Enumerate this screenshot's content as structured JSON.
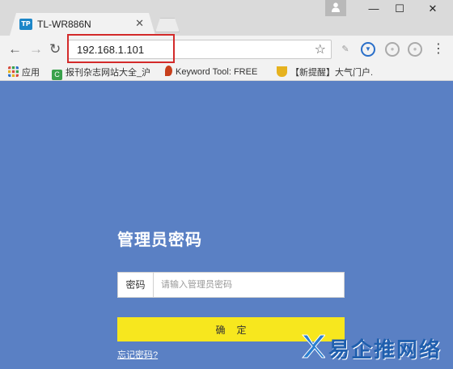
{
  "browser": {
    "tab_title": "TL-WR886N",
    "tab_favicon": "TP",
    "url": "192.168.1.101",
    "window_controls": {
      "minimize": "—",
      "maximize": "☐",
      "close": "✕"
    },
    "nav": {
      "back": "←",
      "forward": "→",
      "reload": "↻",
      "star": "☆",
      "menu": "⋮"
    },
    "extensions": [
      {
        "icon": "leaf-extension-icon",
        "glyph": "✎"
      },
      {
        "icon": "shield-extension-icon",
        "glyph": "▼"
      },
      {
        "icon": "tampermonkey-icon",
        "glyph": "●"
      },
      {
        "icon": "tampermonkey-alt-icon",
        "glyph": "●"
      }
    ]
  },
  "bookmarks": [
    {
      "label": "应用",
      "icon": "apps-grid-icon",
      "color": "#d64c3c"
    },
    {
      "label": "报刊杂志网站大全_沪",
      "icon": "bookmark-c-icon",
      "color": "#3aa14b"
    },
    {
      "label": "Keyword Tool: FREE",
      "icon": "flame-icon",
      "color": "#c73f1c"
    },
    {
      "label": "【新提醒】大气门户.",
      "icon": "trophy-icon",
      "color": "#e6b21f"
    }
  ],
  "login": {
    "heading": "管理员密码",
    "password_label": "密码",
    "password_placeholder": "请输入管理员密码",
    "confirm_label": "确定",
    "forgot_link": "忘记密码?"
  },
  "watermark": {
    "text": "易企推网络"
  },
  "colors": {
    "page_bg": "#5a80c4",
    "confirm_bg": "#f7e71e",
    "highlight": "#d32a2a",
    "brand": "#1c86c8"
  }
}
